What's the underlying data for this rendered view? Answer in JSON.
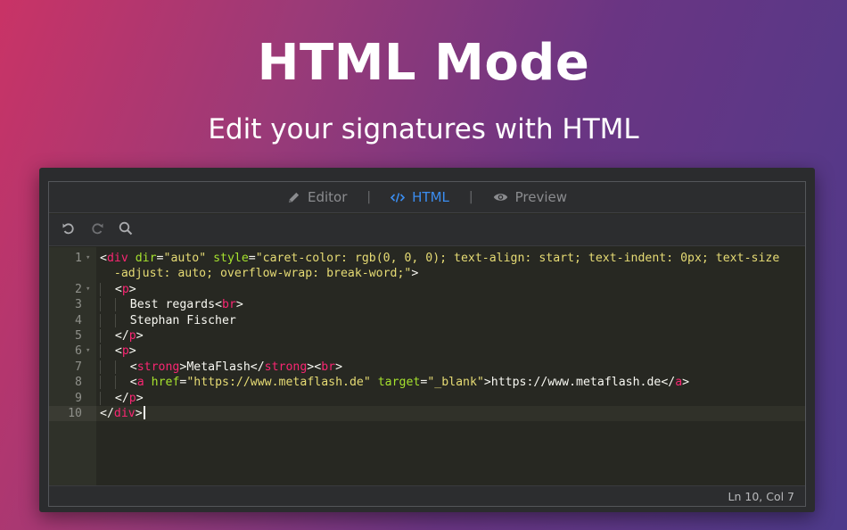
{
  "hero": {
    "title": "HTML Mode",
    "subtitle": "Edit your signatures with HTML"
  },
  "tabs": [
    {
      "label": "Editor",
      "icon": "pencil-icon",
      "active": false
    },
    {
      "label": "HTML",
      "icon": "code-icon",
      "active": true
    },
    {
      "label": "Preview",
      "icon": "eye-icon",
      "active": false
    }
  ],
  "tab_separator": "|",
  "toolbar": {
    "tools": [
      "undo-icon",
      "redo-icon",
      "search-icon"
    ]
  },
  "code": {
    "current_line": 10,
    "lines": [
      {
        "n": "1",
        "fold": true,
        "indent": 0,
        "parts": [
          [
            "p",
            "<"
          ],
          [
            "t",
            "div"
          ],
          [
            "a",
            " dir"
          ],
          [
            "p",
            "="
          ],
          [
            "s",
            "\"auto\""
          ],
          [
            "a",
            " style"
          ],
          [
            "p",
            "="
          ],
          [
            "s",
            "\"caret-color: rgb(0, 0, 0); text-align: start; text-indent: 0px; text-size"
          ]
        ]
      },
      {
        "n": "",
        "fold": false,
        "indent": 0,
        "parts": [
          [
            "s",
            "  -adjust: auto; overflow-wrap: break-word;\""
          ],
          [
            "p",
            ">"
          ]
        ]
      },
      {
        "n": "2",
        "fold": true,
        "indent": 1,
        "parts": [
          [
            "p",
            "<"
          ],
          [
            "t",
            "p"
          ],
          [
            "p",
            ">"
          ]
        ]
      },
      {
        "n": "3",
        "fold": false,
        "indent": 2,
        "parts": [
          [
            "p",
            "Best regards<"
          ],
          [
            "t",
            "br"
          ],
          [
            "p",
            ">"
          ]
        ]
      },
      {
        "n": "4",
        "fold": false,
        "indent": 2,
        "parts": [
          [
            "p",
            "Stephan Fischer"
          ]
        ]
      },
      {
        "n": "5",
        "fold": false,
        "indent": 1,
        "parts": [
          [
            "p",
            "</"
          ],
          [
            "t",
            "p"
          ],
          [
            "p",
            ">"
          ]
        ]
      },
      {
        "n": "6",
        "fold": true,
        "indent": 1,
        "parts": [
          [
            "p",
            "<"
          ],
          [
            "t",
            "p"
          ],
          [
            "p",
            ">"
          ]
        ]
      },
      {
        "n": "7",
        "fold": false,
        "indent": 2,
        "parts": [
          [
            "p",
            "<"
          ],
          [
            "t",
            "strong"
          ],
          [
            "p",
            ">MetaFlash</"
          ],
          [
            "t",
            "strong"
          ],
          [
            "p",
            "><"
          ],
          [
            "t",
            "br"
          ],
          [
            "p",
            ">"
          ]
        ]
      },
      {
        "n": "8",
        "fold": false,
        "indent": 2,
        "parts": [
          [
            "p",
            "<"
          ],
          [
            "t",
            "a"
          ],
          [
            "a",
            " href"
          ],
          [
            "p",
            "="
          ],
          [
            "s",
            "\"https://www.metaflash.de\""
          ],
          [
            "a",
            " target"
          ],
          [
            "p",
            "="
          ],
          [
            "s",
            "\"_blank\""
          ],
          [
            "p",
            ">https://www.metaflash.de</"
          ],
          [
            "t",
            "a"
          ],
          [
            "p",
            ">"
          ]
        ]
      },
      {
        "n": "9",
        "fold": false,
        "indent": 1,
        "parts": [
          [
            "p",
            "</"
          ],
          [
            "t",
            "p"
          ],
          [
            "p",
            ">"
          ]
        ]
      },
      {
        "n": "10",
        "fold": false,
        "indent": 0,
        "parts": [
          [
            "p",
            "</"
          ],
          [
            "t",
            "div"
          ],
          [
            "p",
            ">"
          ]
        ]
      }
    ]
  },
  "status": {
    "position": "Ln 10, Col 7"
  },
  "colors": {
    "active_tab": "#3b8df0",
    "tag": "#f92672",
    "attribute": "#a6e22e",
    "string": "#e6db74",
    "editor_background": "#272822"
  }
}
